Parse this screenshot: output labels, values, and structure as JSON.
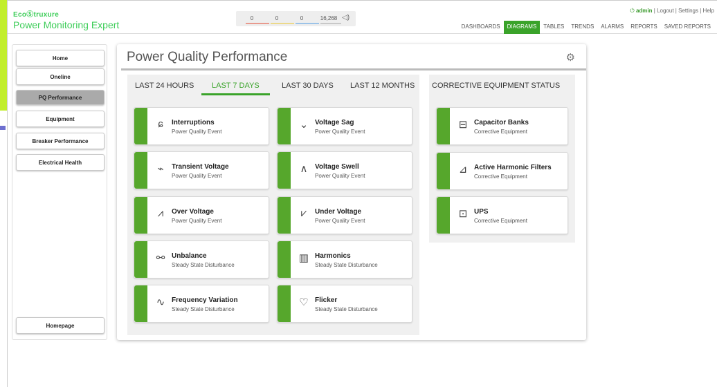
{
  "brand": {
    "top": "EcoⓈtruxure",
    "name": "Power Monitoring Expert"
  },
  "alarms": {
    "counts": [
      "0",
      "0",
      "0",
      "16,268"
    ],
    "colors": [
      "#e89a8e",
      "#ecd98a",
      "#9cc3e8",
      "#c8c8c8"
    ],
    "speaker_icon": "speaker-icon"
  },
  "user": {
    "name": "admin",
    "logout": "Logout",
    "settings": "Settings",
    "help": "Help",
    "sep": "|"
  },
  "nav": [
    "DASHBOARDS",
    "DIAGRAMS",
    "TABLES",
    "TRENDS",
    "ALARMS",
    "REPORTS",
    "SAVED REPORTS"
  ],
  "sidebar": [
    "Home",
    "Oneline",
    "PQ Performance",
    "Equipment",
    "Breaker Performance",
    "Electrical Health"
  ],
  "sidebar_bottom": "Homepage",
  "page": {
    "title": "Power Quality Performance",
    "settings_icon": "gear-icon"
  },
  "tabs": [
    "LAST 24 HOURS",
    "LAST 7 DAYS",
    "LAST 30 DAYS",
    "LAST 12 MONTHS"
  ],
  "selected_tab": "LAST 7 DAYS",
  "ces_title": "CORRECTIVE EQUIPMENT STATUS",
  "cards": [
    {
      "title": "Interruptions",
      "sub": "Power Quality Event",
      "icon": "interruption-icon"
    },
    {
      "title": "Voltage Sag",
      "sub": "Power Quality Event",
      "icon": "voltage-sag-icon"
    },
    {
      "title": "Transient Voltage",
      "sub": "Power Quality Event",
      "icon": "transient-icon"
    },
    {
      "title": "Voltage Swell",
      "sub": "Power Quality Event",
      "icon": "voltage-swell-icon"
    },
    {
      "title": "Over Voltage",
      "sub": "Power Quality Event",
      "icon": "over-voltage-icon"
    },
    {
      "title": "Under Voltage",
      "sub": "Power Quality Event",
      "icon": "under-voltage-icon"
    },
    {
      "title": "Unbalance",
      "sub": "Steady State Disturbance",
      "icon": "unbalance-icon"
    },
    {
      "title": "Harmonics",
      "sub": "Steady State Disturbance",
      "icon": "harmonics-icon"
    },
    {
      "title": "Frequency Variation",
      "sub": "Steady State Disturbance",
      "icon": "frequency-icon"
    },
    {
      "title": "Flicker",
      "sub": "Steady State Disturbance",
      "icon": "flicker-icon"
    }
  ],
  "equipment": [
    {
      "title": "Capacitor Banks",
      "sub": "Corrective Equipment",
      "icon": "capacitor-icon"
    },
    {
      "title": "Active Harmonic Filters",
      "sub": "Corrective Equipment",
      "icon": "harmonic-filter-icon"
    },
    {
      "title": "UPS",
      "sub": "Corrective Equipment",
      "icon": "ups-icon"
    }
  ],
  "accent": "#3aa32a"
}
